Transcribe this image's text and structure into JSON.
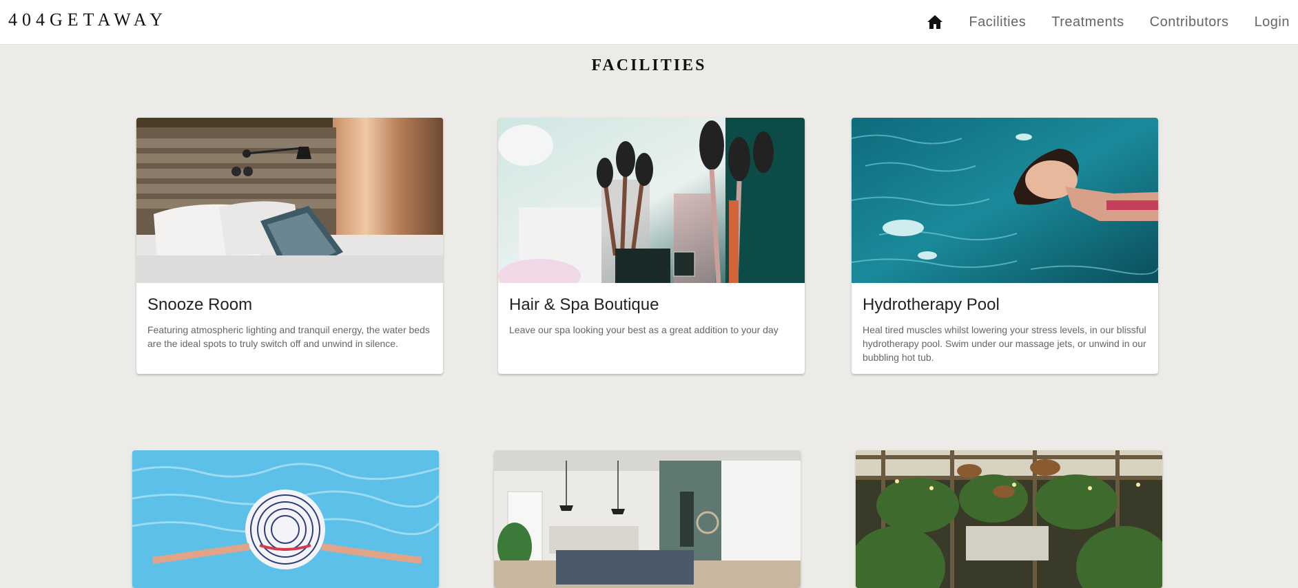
{
  "brand": "404GETAWAY",
  "nav": {
    "home_icon": "home-icon",
    "links": [
      "Facilities",
      "Treatments",
      "Contributors",
      "Login"
    ]
  },
  "page_title": "FACILITIES",
  "cards": [
    {
      "title": "Snooze Room",
      "text": "Featuring atmospheric lighting and tranquil energy, the water beds are the ideal spots to truly switch off and unwind in silence.",
      "image": "bedroom-photo"
    },
    {
      "title": "Hair & Spa Boutique",
      "text": "Leave our spa looking your best as a great addition to your day",
      "image": "makeup-brushes-photo"
    },
    {
      "title": "Hydrotherapy Pool",
      "text": "Heal tired muscles whilst lowering your stress levels, in our blissful hydrotherapy pool. Swim under our massage jets, or unwind in our bubbling hot tub.",
      "image": "woman-floating-pool-photo"
    },
    {
      "image": "pool-sunhat-photo"
    },
    {
      "image": "lounge-interior-photo"
    },
    {
      "image": "garden-pergola-photo"
    }
  ],
  "colors": {
    "background": "#ecebe7",
    "navbar": "#ffffff",
    "text_dark": "#222222",
    "text_muted": "#666666"
  }
}
